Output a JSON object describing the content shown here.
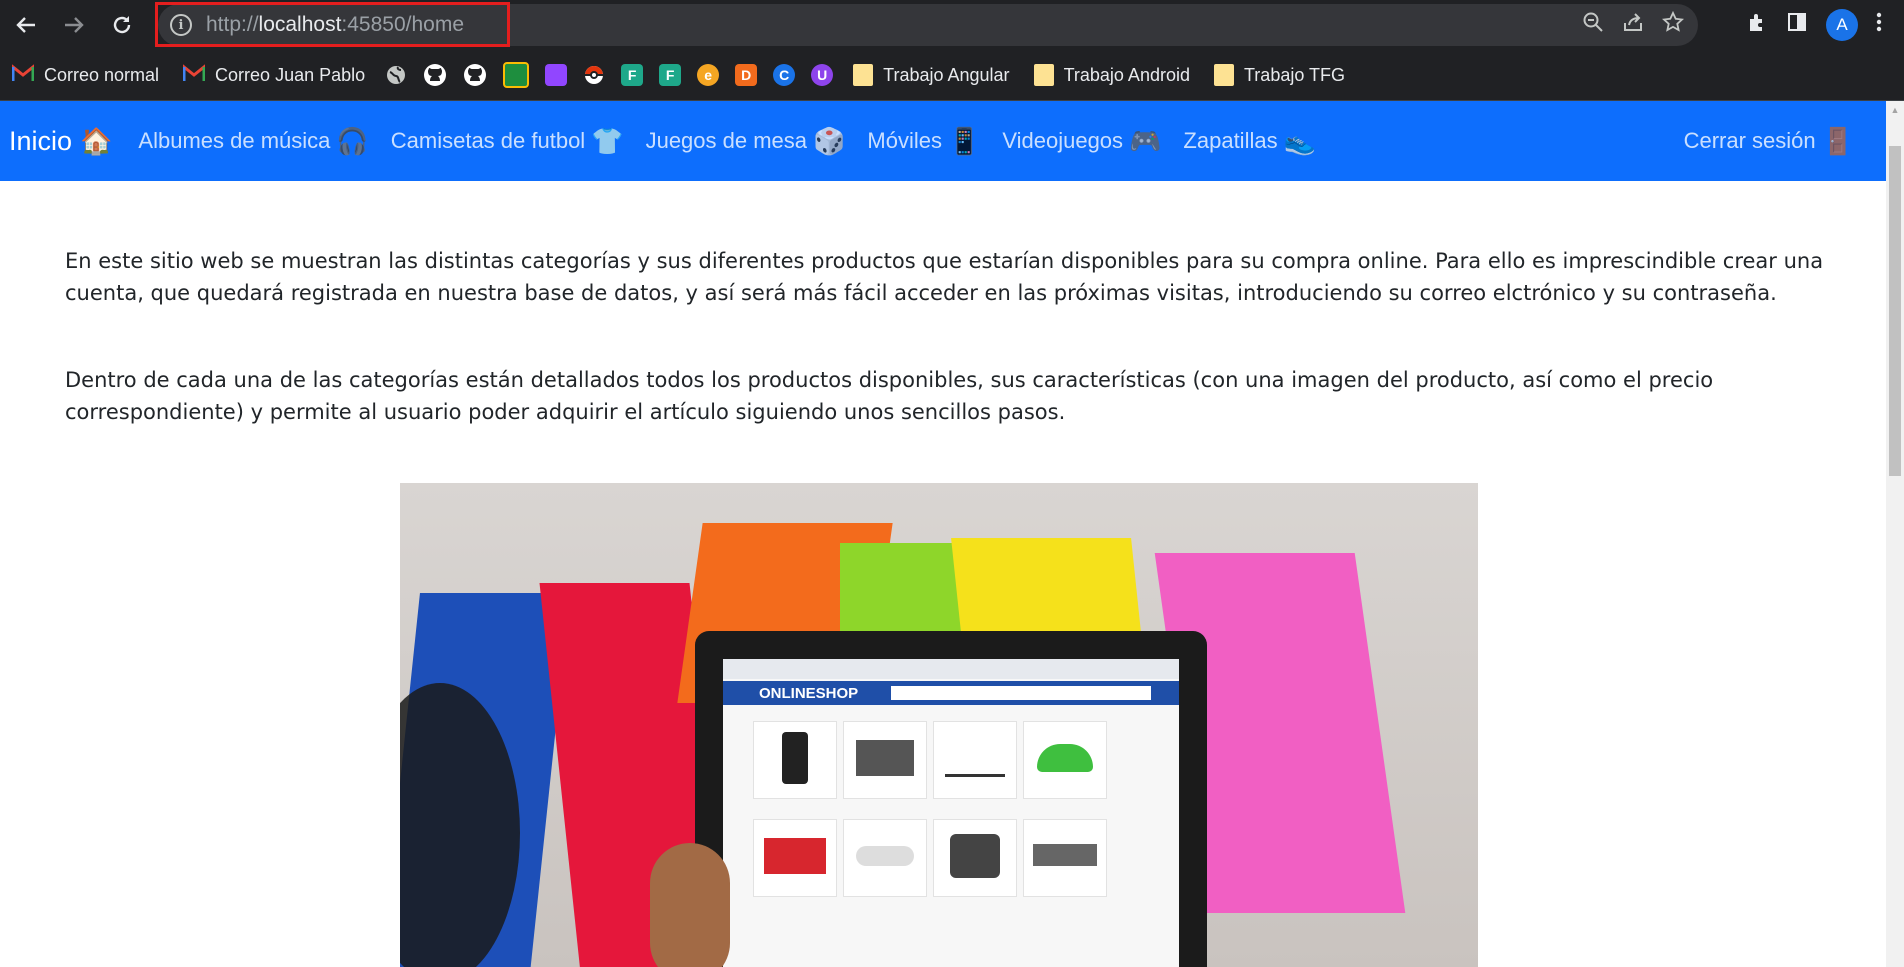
{
  "browser": {
    "url_scheme": "http://",
    "url_host": "localhost",
    "url_rest": ":45850/home",
    "profile_initial": "A",
    "bookmarks": [
      {
        "label": "Correo normal",
        "icon": "gmail-icon"
      },
      {
        "label": "Correo Juan Pablo",
        "icon": "gmail-icon"
      },
      {
        "label": "Trabajo Angular",
        "icon": "folder-icon"
      },
      {
        "label": "Trabajo Android",
        "icon": "folder-icon"
      },
      {
        "label": "Trabajo TFG",
        "icon": "folder-icon"
      }
    ]
  },
  "navbar": {
    "brand": "Inicio",
    "links": [
      {
        "label": "Albumes de música",
        "icon": "headphones-icon"
      },
      {
        "label": "Camisetas de futbol",
        "icon": "tshirt-icon"
      },
      {
        "label": "Juegos de mesa",
        "icon": "board-game-icon"
      },
      {
        "label": "Móviles",
        "icon": "mobile-phone-icon"
      },
      {
        "label": "Videojuegos",
        "icon": "gamepad-icon"
      },
      {
        "label": "Zapatillas",
        "icon": "sneaker-icon"
      }
    ],
    "logout": "Cerrar sesión"
  },
  "content": {
    "paragraph1": "En este sitio web se muestran las distintas categorías y sus diferentes productos que estarían disponibles para su compra online. Para ello es imprescindible crear una cuenta, que quedará registrada en nuestra base de datos, y así será más fácil acceder en las próximas visitas, introduciendo su correo elctrónico y su contraseña.",
    "paragraph2": "Dentro de cada una de las categorías están detallados todos los productos disponibles, sus características (con una imagen del producto, así como el precio correspondiente) y permite al usuario poder adquirir el artículo siguiendo unos sencillos pasos.",
    "hero_shop_title": "ONLINESHOP"
  },
  "colors": {
    "navbar": "#0d6efd",
    "chrome": "#202124",
    "highlight": "#e41e1e"
  }
}
